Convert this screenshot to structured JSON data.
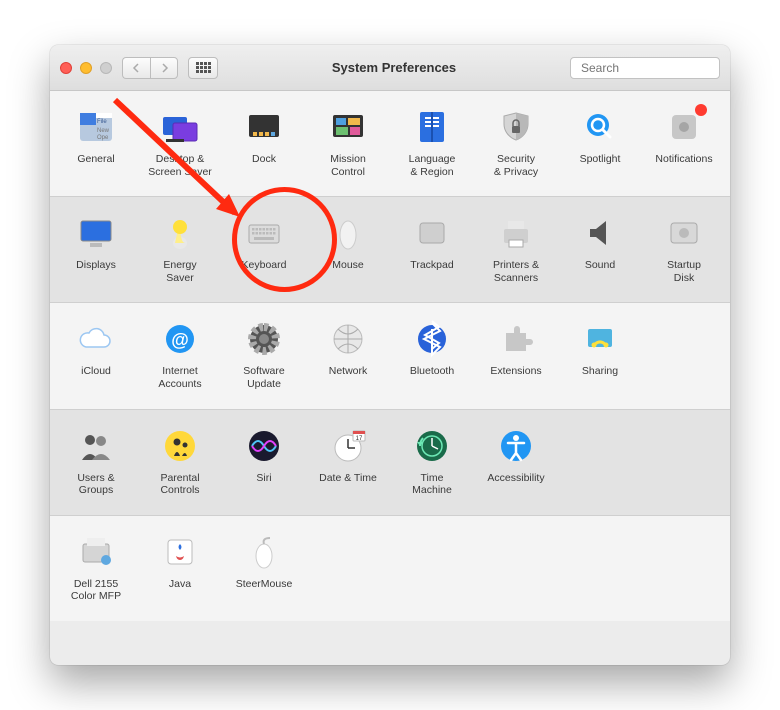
{
  "window": {
    "title": "System Preferences"
  },
  "search": {
    "placeholder": "Search"
  },
  "rows": [
    {
      "tone": "light",
      "items": [
        {
          "key": "general",
          "label": "General"
        },
        {
          "key": "desktop",
          "label": "Desktop &\nScreen Saver"
        },
        {
          "key": "dock",
          "label": "Dock"
        },
        {
          "key": "mission",
          "label": "Mission\nControl"
        },
        {
          "key": "language",
          "label": "Language\n& Region"
        },
        {
          "key": "security",
          "label": "Security\n& Privacy"
        },
        {
          "key": "spotlight",
          "label": "Spotlight"
        },
        {
          "key": "notifications",
          "label": "Notifications",
          "badge": true
        }
      ]
    },
    {
      "tone": "dark",
      "items": [
        {
          "key": "displays",
          "label": "Displays"
        },
        {
          "key": "energy",
          "label": "Energy\nSaver"
        },
        {
          "key": "keyboard",
          "label": "Keyboard",
          "highlighted": true
        },
        {
          "key": "mouse",
          "label": "Mouse"
        },
        {
          "key": "trackpad",
          "label": "Trackpad"
        },
        {
          "key": "printers",
          "label": "Printers &\nScanners"
        },
        {
          "key": "sound",
          "label": "Sound"
        },
        {
          "key": "startup",
          "label": "Startup\nDisk"
        }
      ]
    },
    {
      "tone": "light",
      "items": [
        {
          "key": "icloud",
          "label": "iCloud"
        },
        {
          "key": "internet",
          "label": "Internet\nAccounts"
        },
        {
          "key": "software",
          "label": "Software\nUpdate"
        },
        {
          "key": "network",
          "label": "Network"
        },
        {
          "key": "bluetooth",
          "label": "Bluetooth"
        },
        {
          "key": "extensions",
          "label": "Extensions"
        },
        {
          "key": "sharing",
          "label": "Sharing"
        }
      ]
    },
    {
      "tone": "dark",
      "items": [
        {
          "key": "users",
          "label": "Users &\nGroups"
        },
        {
          "key": "parental",
          "label": "Parental\nControls"
        },
        {
          "key": "siri",
          "label": "Siri"
        },
        {
          "key": "datetime",
          "label": "Date & Time"
        },
        {
          "key": "timemachine",
          "label": "Time\nMachine"
        },
        {
          "key": "accessibility",
          "label": "Accessibility"
        }
      ]
    },
    {
      "tone": "light",
      "items": [
        {
          "key": "dell",
          "label": "Dell 2155\nColor MFP"
        },
        {
          "key": "java",
          "label": "Java"
        },
        {
          "key": "steermouse",
          "label": "SteerMouse"
        }
      ]
    }
  ],
  "annotation": {
    "highlight_target": "keyboard"
  }
}
